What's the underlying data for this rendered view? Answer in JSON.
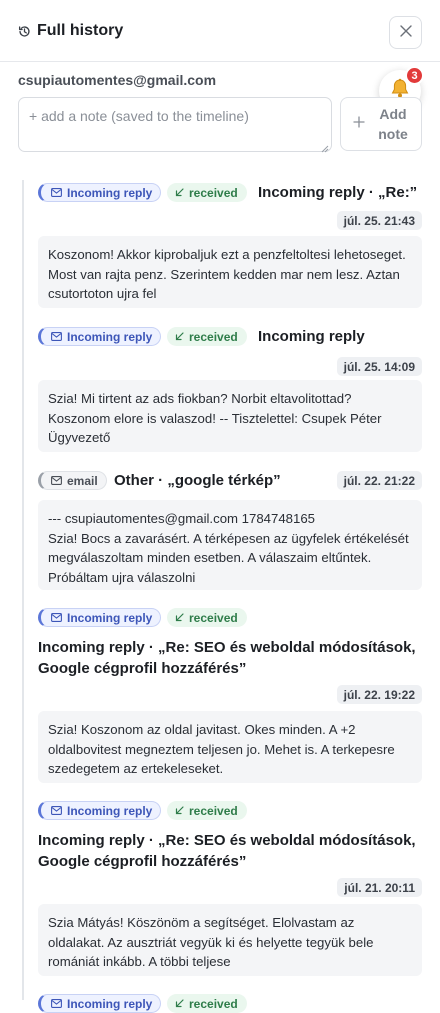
{
  "header": {
    "title": "Full history"
  },
  "contact": {
    "email": "csupiautomentes@gmail.com"
  },
  "notifications": {
    "count": "3"
  },
  "note": {
    "placeholder": "+ add a note (saved to the timeline)",
    "value": "",
    "add_label": "Add note"
  },
  "entries": [
    {
      "source": "Incoming reply",
      "status": "received",
      "title": "Incoming reply · „Re:”",
      "time": "júl. 25. 21:43",
      "body": "Koszonom! Akkor kiprobaljuk ezt a penzfeltoltesi lehetoseget. Most van rajta penz. Szerintem kedden mar nem lesz. Aztan csutortoton ujra fel"
    },
    {
      "source": "Incoming reply",
      "status": "received",
      "title": "Incoming reply",
      "time": "júl. 25. 14:09",
      "body": "Szia! Mi tirtent az ads fiokban? Norbit eltavolitottad? Koszonom elore is valaszod! -- Tisztelettel: Csupek Péter Ügyvezető"
    },
    {
      "source": "email",
      "status": "",
      "title": "Other · „google térkép”",
      "time": "júl. 22. 21:22",
      "body": "--- csupiautomentes@gmail.com 1784748165\nSzia! Bocs a zavarásért. A térképesen az ügyfelek értékelését megválaszoltam minden esetben. A válaszaim eltűntek. Próbáltam ujra válaszolni"
    },
    {
      "source": "Incoming reply",
      "status": "received",
      "title": "Incoming reply · „Re: SEO és weboldal módosítások, Google cégprofil hozzáférés”",
      "time": "júl. 22. 19:22",
      "body": "Szia! Koszonom az oldal javitast. Okes minden. A +2 oldalbovitest megneztem teljesen jo. Mehet is. A terkepesre szedegetem az ertekeleseket."
    },
    {
      "source": "Incoming reply",
      "status": "received",
      "title": "Incoming reply · „Re: SEO és weboldal módosítások, Google cégprofil hozzáférés”",
      "time": "júl. 21. 20:11",
      "body": "Szia Mátyás! Köszönöm a segítséget. Elolvastam az oldalakat. Az ausztriát vegyük ki és helyette tegyük bele romániát inkább. A többi teljese"
    },
    {
      "source": "Incoming reply",
      "status": "received"
    }
  ]
}
